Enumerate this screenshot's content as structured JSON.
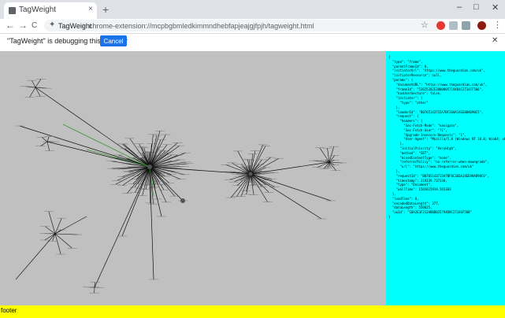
{
  "browser": {
    "tab_title": "TagWeight",
    "tab_close": "×",
    "new_tab": "+",
    "window_buttons": [
      "–",
      "□",
      "✕"
    ],
    "nav": [
      "←",
      "→",
      "C"
    ],
    "extension_name": "TagWeight",
    "separator": "|",
    "url": "chrome-extension://mcpbgbmledkimmndhebfapjeajgjfpjh/tagweight.html",
    "star": "☆",
    "extension_icons": [
      {
        "name": "abp",
        "color": "#e53935"
      },
      {
        "name": "ext-2",
        "color": "#b0bec5"
      },
      {
        "name": "ext-3",
        "color": "#90a4ae"
      },
      {
        "name": "ext-4",
        "color": "#78909c"
      },
      {
        "name": "profile",
        "color": "#8d1b10"
      }
    ],
    "menu": "⋮"
  },
  "infobar": {
    "message": "\"TagWeight\" is debugging this browser",
    "cancel_label": "Cancel",
    "close": "✕"
  },
  "json_panel": {
    "lines": [
      "{",
      "  \"type\": \"frame\",",
      "  \"parentFrameId\": 0,",
      "  \"initiatorUrl\": \"https://www.theguardian.com/uk\",",
      "  \"initiatorResource\": null,",
      "  \"params\": {",
      "    \"documentURL\": \"https://www.theguardian.com/uk\",",
      "    \"frameId\": \"53625202E28000057194D4C2734FF566\",",
      "    \"hasUserGesture\": false,",
      "    \"initiator\": {",
      "      \"type\": \"other\"",
      "    },",
      "    \"loaderId\": \"B0765143715A7BF204A14EE88AD90C5\",",
      "    \"request\": {",
      "      \"headers\": {",
      "        \"Sec-Fetch-Mode\": \"navigate\",",
      "        \"Sec-Fetch-User\": \"?1\",",
      "        \"Upgrade-Insecure-Requests\": \"1\",",
      "        \"User-Agent\": \"Mozilla/5.0 (Windows NT 10.0; Win64; x64)",
      "      },",
      "      \"initialPriority\": \"VeryHigh\",",
      "      \"method\": \"GET\",",
      "      \"mixedContentType\": \"none\",",
      "      \"referrerPolicy\": \"no-referrer-when-downgrade\",",
      "      \"url\": \"https://www.theguardian.com/uk\"",
      "    },",
      "    \"requestId\": \"B0765143715A7BF8C3E6A14EE98AD90C6\",",
      "    \"timestamp\": 319239.737330,",
      "    \"type\": \"Document\",",
      "    \"wallTime\": 1565615919.565383",
      "  },",
      "  \"loadTime\": 0,",
      "  \"encodedDataLength\": 377,",
      "  \"dataLength\": 550625,",
      "  \"uuId\": \"1DA2E3F212AB8B025794D8C27346F56B\"",
      "}"
    ]
  },
  "footer": {
    "text": "footer"
  }
}
